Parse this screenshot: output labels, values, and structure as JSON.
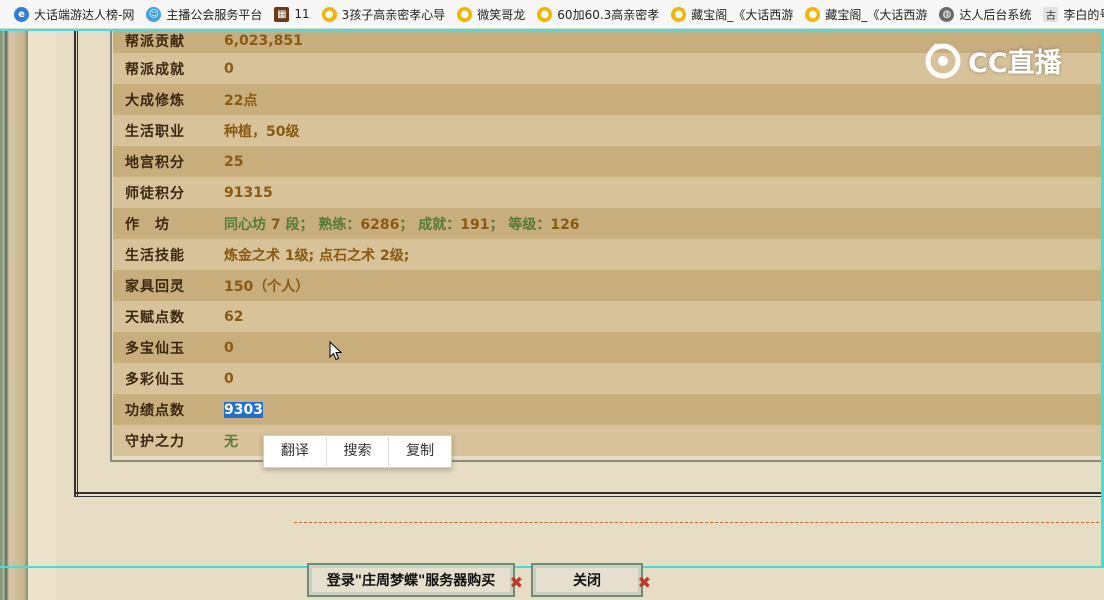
{
  "bookmarks": [
    {
      "icon": "e-browser-icon",
      "label": "大话端游达人榜-网"
    },
    {
      "icon": "smiley-icon",
      "label": "主播公会服务平台"
    },
    {
      "icon": "game-thumb-icon",
      "label": "11"
    },
    {
      "icon": "duck-icon",
      "label": "3孩子高亲密孝心导"
    },
    {
      "icon": "duck-icon",
      "label": "微笑哥龙"
    },
    {
      "icon": "duck-icon",
      "label": "60加60.3高亲密孝"
    },
    {
      "icon": "duck-icon",
      "label": "藏宝阁_《大话西游"
    },
    {
      "icon": "duck-icon",
      "label": "藏宝阁_《大话西游"
    },
    {
      "icon": "globe-icon",
      "label": "达人后台系统"
    },
    {
      "icon": "gu-icon",
      "label": "李白的号"
    }
  ],
  "rows": [
    {
      "label": "帮派贡献",
      "value": "6,023,851"
    },
    {
      "label": "帮派成就",
      "value": "0"
    },
    {
      "label": "大成修炼",
      "value": "22点"
    },
    {
      "label": "生活职业",
      "value": "种植，50级"
    },
    {
      "label": "地宫积分",
      "value": "25"
    },
    {
      "label": "师徒积分",
      "value": "91315"
    },
    {
      "label": "作　坊",
      "value": ""
    },
    {
      "label": "生活技能",
      "value": "炼金之术 1级; 点石之术 2级;"
    },
    {
      "label": "家具回灵",
      "value": "150（个人）"
    },
    {
      "label": "天赋点数",
      "value": "62"
    },
    {
      "label": "多宝仙玉",
      "value": "0"
    },
    {
      "label": "多彩仙玉",
      "value": "0"
    },
    {
      "label": "功绩点数",
      "value": "9303"
    },
    {
      "label": "守护之力",
      "value": "无"
    }
  ],
  "workshop": {
    "name": "同心坊",
    "level": "7",
    "duan": "段；",
    "skill_label": "熟练：",
    "skill": "6286",
    "sep1": "；",
    "achieve_label": "成就：",
    "achieve": "191",
    "sep2": "；",
    "grade_label": "等级：",
    "grade": "126"
  },
  "context_menu": [
    "翻译",
    "搜索",
    "复制"
  ],
  "watermark": "CC直播",
  "buttons": {
    "login_buy": "登录\"庄周梦蝶\"服务器购买",
    "close": "关闭"
  }
}
